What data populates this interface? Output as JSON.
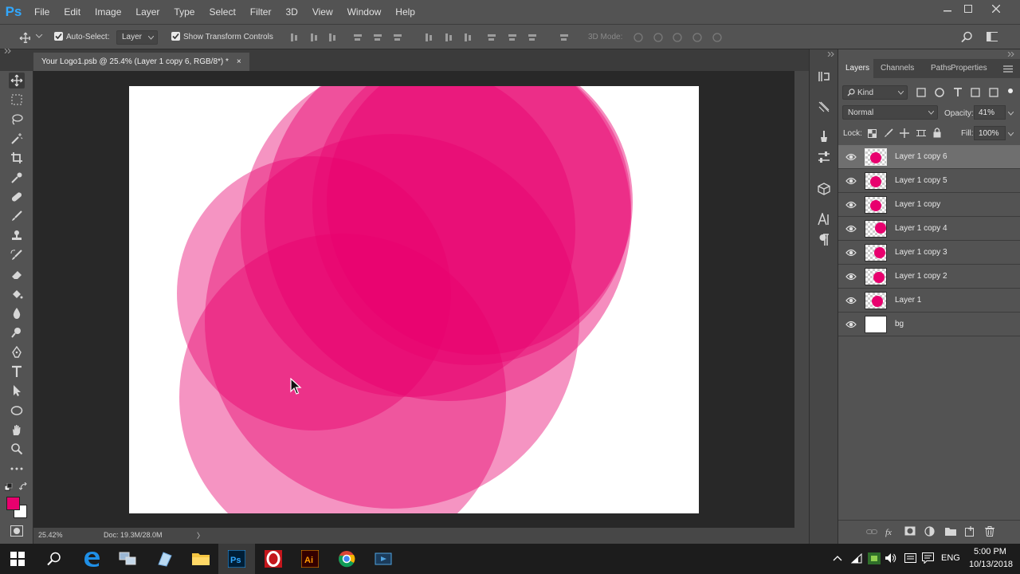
{
  "app": {
    "logo": "Ps"
  },
  "menu": [
    "File",
    "Edit",
    "Image",
    "Layer",
    "Type",
    "Select",
    "Filter",
    "3D",
    "View",
    "Window",
    "Help"
  ],
  "options": {
    "auto_select_label": "Auto-Select:",
    "auto_select_checked": true,
    "auto_select_value": "Layer",
    "show_transform_label": "Show Transform Controls",
    "show_transform_checked": true,
    "mode_3d_label": "3D Mode:"
  },
  "document": {
    "tab_title": "Your Logo1.psb @ 25.4% (Layer 1 copy 6, RGB/8*) *",
    "close_glyph": "×"
  },
  "status": {
    "zoom": "25.42%",
    "doc_size": "Doc: 19.3M/28.0M",
    "arrow": "〉"
  },
  "panels": {
    "tabs": [
      "Layers",
      "Channels",
      "Paths",
      "Properties"
    ],
    "active_tab": "Layers",
    "filter_kind": "Kind",
    "blend_mode": "Normal",
    "opacity_label": "Opacity:",
    "opacity_value": "41%",
    "lock_label": "Lock:",
    "fill_label": "Fill:",
    "fill_value": "100%"
  },
  "layers": [
    {
      "name": "Layer 1 copy 6",
      "selected": true,
      "thumb": "dot"
    },
    {
      "name": "Layer 1 copy 5",
      "selected": false,
      "thumb": "dot"
    },
    {
      "name": "Layer 1 copy",
      "selected": false,
      "thumb": "dot"
    },
    {
      "name": "Layer 1 copy 4",
      "selected": false,
      "thumb": "dot"
    },
    {
      "name": "Layer 1 copy 3",
      "selected": false,
      "thumb": "dot"
    },
    {
      "name": "Layer 1 copy 2",
      "selected": false,
      "thumb": "dot"
    },
    {
      "name": "Layer 1",
      "selected": false,
      "thumb": "dot"
    },
    {
      "name": "bg",
      "selected": false,
      "thumb": "white"
    }
  ],
  "colors": {
    "foreground": "#e8006e",
    "background": "#ffffff",
    "circle": "#e8006e",
    "ps_blue": "#31a8ff"
  },
  "taskbar": {
    "language": "ENG",
    "time": "5:00 PM",
    "date": "10/13/2018",
    "apps": [
      "start-icon",
      "search-icon",
      "edge-icon",
      "network-icon",
      "app-icon",
      "file-explorer-icon",
      "photoshop-icon",
      "opera-icon",
      "illustrator-icon",
      "chrome-icon",
      "media-icon"
    ],
    "illustrator_label": "Ai",
    "photoshop_label": "Ps"
  }
}
